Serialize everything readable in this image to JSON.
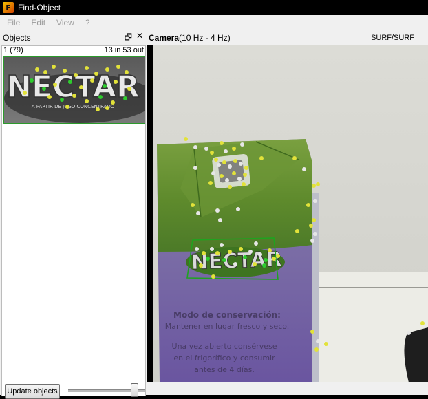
{
  "window": {
    "title": "Find-Object"
  },
  "menu": [
    "File",
    "Edit",
    "View",
    "?"
  ],
  "objects_dock": {
    "title": "Objects",
    "float_icon": "restore-icon",
    "close_icon": "close-icon",
    "object_id": "1 (79)",
    "inlier_summary": "13 in 53 out",
    "thumbnail_text": "NECTAR",
    "thumbnail_subtext": "A PARTIR DE JUGO CONCENTRADO",
    "update_button": "Update objects",
    "slider_value": 0.9
  },
  "camera": {
    "label": "Camera",
    "rate": "(10 Hz - 4 Hz)",
    "detector": "SURF/SURF",
    "carton_logo": "NECTAR",
    "carton_text_1": "Modo de conservación:",
    "carton_text_2": "Mantener en lugar fresco y seco.",
    "carton_text_3": "Una vez abierto consérvese",
    "carton_text_4": "en el frigorífico y consumir",
    "carton_text_5": "antes de 4 días."
  },
  "colors": {
    "inlier": "#2ecc2e",
    "outlier": "#e2e23a",
    "unmatched": "#e6e6e6",
    "detection_box": "#1fa31f"
  }
}
